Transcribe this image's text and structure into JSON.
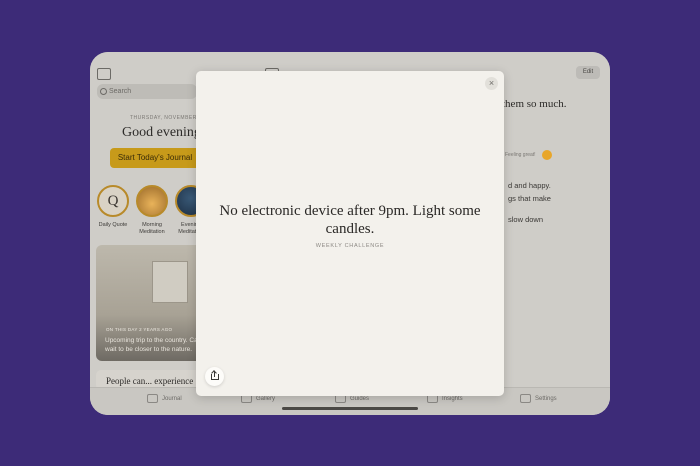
{
  "background": {
    "frame_color": "#3d2b78"
  },
  "toolbar": {
    "edit_label": "Edit"
  },
  "sidebar": {
    "search_placeholder": "Search",
    "date": "THURSDAY, NOVEMBER 9",
    "greeting": "Good evening,",
    "start_button": "Start Today's Journal",
    "circles": [
      {
        "label": "Daily Quote",
        "glyph": "Q"
      },
      {
        "label": "Morning Meditation"
      },
      {
        "label": "Evening Meditation"
      }
    ],
    "memory_card": {
      "tag": "ON THIS DAY 2 YEARS AGO",
      "text_line1": "Upcoming trip to the country. Can't",
      "text_line2": "wait to be closer to the nature."
    },
    "quote_preview": "People can... experience"
  },
  "entry": {
    "heading": "them so much.",
    "feeling": "Feeling great!",
    "lines": [
      "d and happy.",
      "gs that make",
      "slow down"
    ]
  },
  "tabs": [
    {
      "label": "Journal"
    },
    {
      "label": "Gallery"
    },
    {
      "label": "Guides"
    },
    {
      "label": "Insights"
    },
    {
      "label": "Settings"
    }
  ],
  "modal": {
    "close_glyph": "×",
    "challenge_text": "No electronic device after 9pm. Light some candles.",
    "challenge_tag": "WEEKLY CHALLENGE"
  },
  "colors": {
    "accent": "#c79a1a",
    "modal_bg": "#f3f1ec"
  }
}
